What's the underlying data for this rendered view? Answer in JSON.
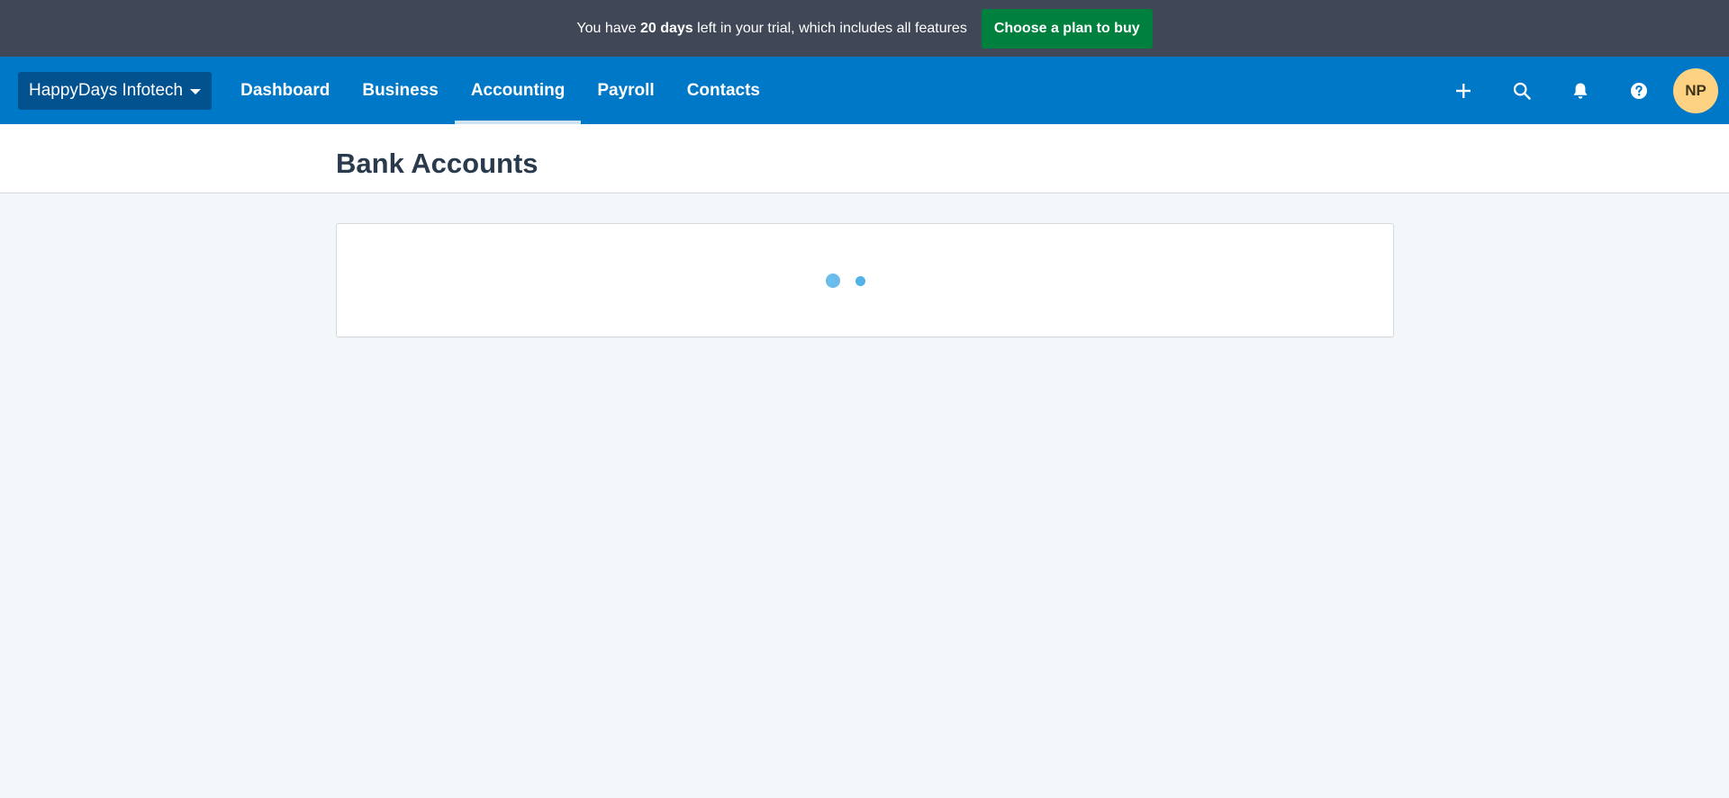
{
  "trial_banner": {
    "text_prefix": "You have ",
    "days": "20 days",
    "text_suffix": " left in your trial, which includes all features",
    "cta_label": "Choose a plan to buy"
  },
  "nav": {
    "org_name": "HappyDays Infotech",
    "tabs": [
      {
        "label": "Dashboard",
        "active": false
      },
      {
        "label": "Business",
        "active": false
      },
      {
        "label": "Accounting",
        "active": true
      },
      {
        "label": "Payroll",
        "active": false
      },
      {
        "label": "Contacts",
        "active": false
      }
    ],
    "icons": [
      "plus-icon",
      "search-icon",
      "bell-icon",
      "help-icon"
    ],
    "avatar_initials": "NP"
  },
  "page": {
    "title": "Bank Accounts"
  },
  "colors": {
    "banner_bg": "#404756",
    "cta_green": "#00803f",
    "nav_blue": "#0078c8",
    "org_switcher_bg": "#025290",
    "avatar_bg": "#fdd282",
    "loader_dot": "#50b2e6",
    "page_bg": "#f3f7fa"
  }
}
